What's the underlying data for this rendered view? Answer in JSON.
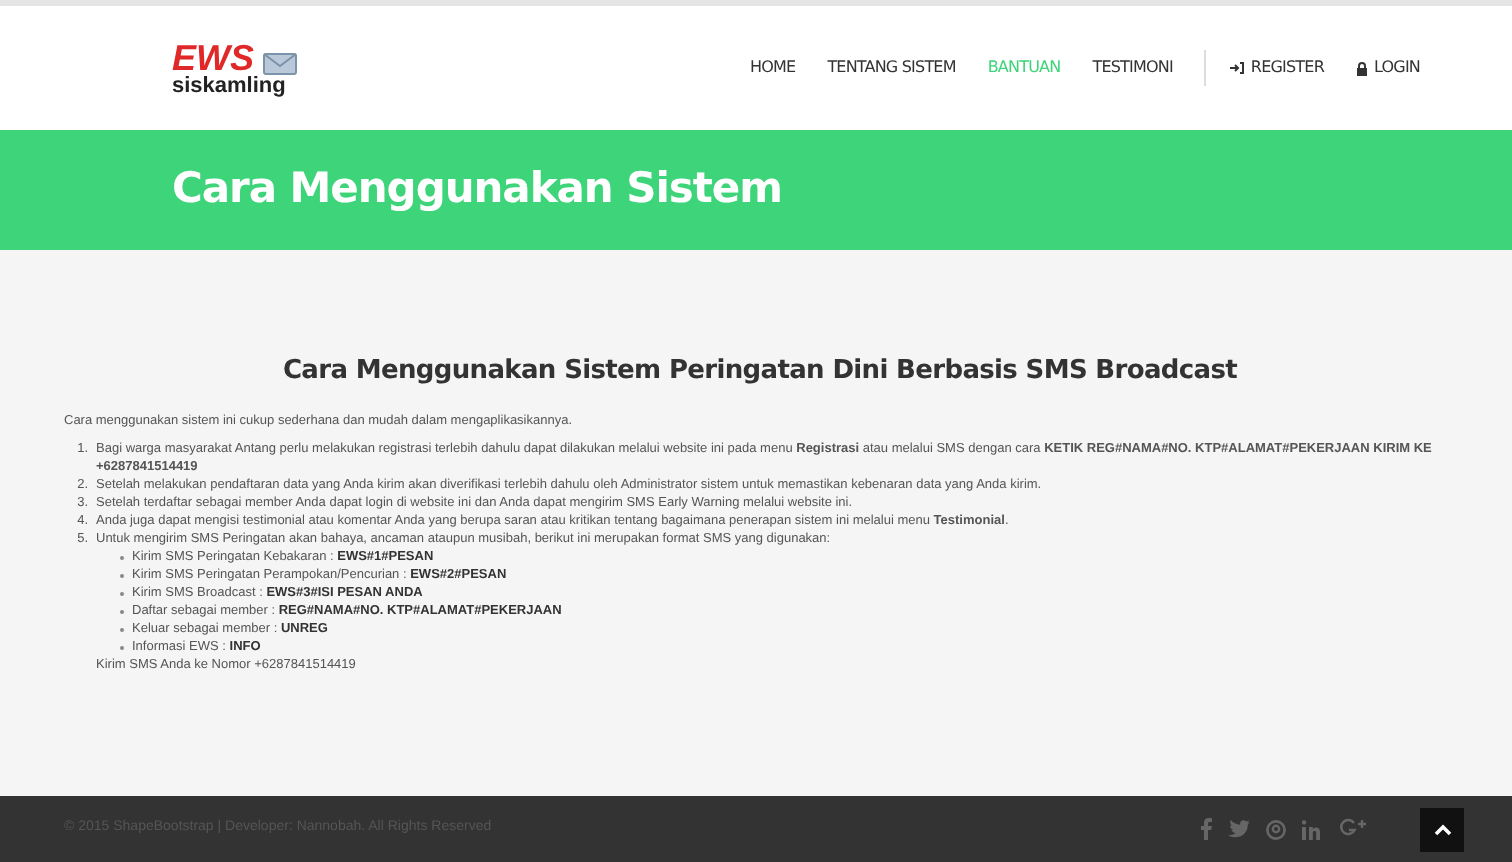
{
  "header": {
    "logo": {
      "top": "EWS",
      "bottom": "siskamling"
    },
    "nav": [
      {
        "label": "HOME",
        "selected": false
      },
      {
        "label": "TENTANG SISTEM",
        "selected": false
      },
      {
        "label": "BANTUAN",
        "selected": true
      },
      {
        "label": "TESTIMONI",
        "selected": false
      },
      {
        "label": "REGISTER",
        "selected": false
      },
      {
        "label": "LOGIN",
        "selected": false
      }
    ]
  },
  "banner": {
    "title": "Cara Menggunakan Sistem"
  },
  "content": {
    "heading": "Cara Menggunakan Sistem Peringatan Dini Berbasis SMS Broadcast",
    "intro": "Cara menggunakan sistem ini cukup sederhana dan mudah dalam mengaplikasikannya.",
    "steps": [
      {
        "number": "1.",
        "text": "Bagi warga masyarakat Antang perlu melakukan registrasi terlebih dahulu dapat dilakukan melalui website ini pada menu **Registrasi** atau melalui SMS dengan cara **KETIK REG#NAMA#NO. KTP#ALAMAT#PEKERJAAN KIRIM KE +6287841514419**"
      },
      {
        "number": "2.",
        "text": "Setelah melakukan pendaftaran data yang Anda kirim akan diverifikasi terlebih dahulu oleh Administrator sistem untuk memastikan kebenaran data yang Anda kirim."
      },
      {
        "number": "3.",
        "text": "Setelah terdaftar sebagai member Anda dapat login di website ini dan Anda dapat mengirim SMS Early Warning melalui website ini."
      },
      {
        "number": "4.",
        "text": "Anda juga dapat mengisi testimonial atau komentar Anda yang berupa saran atau kritikan tentang bagaimana penerapan sistem ini melalui menu **Testimonial**."
      },
      {
        "number": "5.",
        "text": "Untuk mengirim SMS Peringatan akan bahaya, ancaman ataupun musibah, berikut ini merupakan format SMS yang digunakan:",
        "formats": [
          {
            "label": "Kirim SMS Peringatan Kebakaran : ",
            "code": "EWS#1#PESAN"
          },
          {
            "label": "Kirim SMS Peringatan Perampokan/Pencurian : ",
            "code": "EWS#2#PESAN"
          },
          {
            "label": "Kirim SMS Broadcast : ",
            "code": "EWS#3#ISI PESAN ANDA"
          },
          {
            "label": "Daftar sebagai member : ",
            "code": "REG#NAMA#NO. KTP#ALAMAT#PEKERJAAN"
          },
          {
            "label": "Keluar sebagai member : ",
            "code": "UNREG"
          },
          {
            "label": "Informasi EWS : ",
            "code": "INFO"
          }
        ]
      }
    ],
    "note": "Kirim SMS Anda ke Nomor +6287841514419"
  },
  "footer": {
    "copyright": "© 2015 ShapeBootstrap | Developer: Nannobah. All Rights Reserved"
  }
}
